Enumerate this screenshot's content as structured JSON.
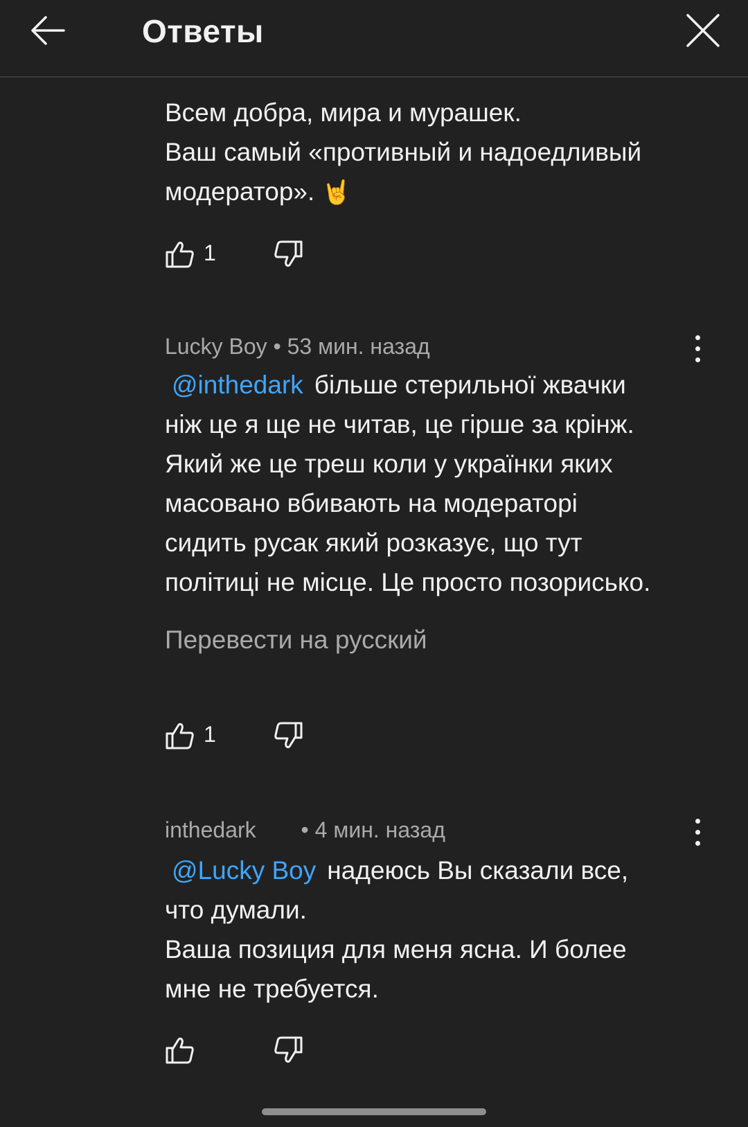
{
  "header": {
    "title": "Ответы"
  },
  "comments": [
    {
      "lines": [
        "Всем добра, мира и мурашек.",
        "Ваш самый «противный и надоедливый",
        "модератор».",
        "🤘"
      ],
      "likes": "1"
    },
    {
      "author": "Lucky Boy",
      "time": "• 53 мин. назад",
      "mention": "@inthedark",
      "lines": [
        "більше стерильної жвачки",
        "ніж це я ще не читав, це гірше за крінж.",
        "Який же це треш коли у українки яких",
        "масовано вбивають на модераторі",
        "сидить русак який  розказує, що тут",
        "політиці не місце. Це просто позорисько."
      ],
      "translate_label": "Перевести на русский",
      "likes": "1"
    },
    {
      "author": "inthedark",
      "time": "• 4 мин. назад",
      "mention": "@Lucky Boy",
      "lines": [
        "надеюсь Вы сказали все,",
        "что думали.",
        "Ваша позиция для меня ясна. И более",
        "мне не требуется."
      ]
    }
  ],
  "icons": {
    "back": "arrow-left-icon",
    "close": "close-icon",
    "like": "thumbs-up-icon",
    "dislike": "thumbs-down-icon",
    "more": "more-vertical-icon"
  },
  "colors": {
    "background": "#212121",
    "text": "#f1f1f1",
    "secondary": "#aaaaaa",
    "link": "#3ea6ff"
  }
}
